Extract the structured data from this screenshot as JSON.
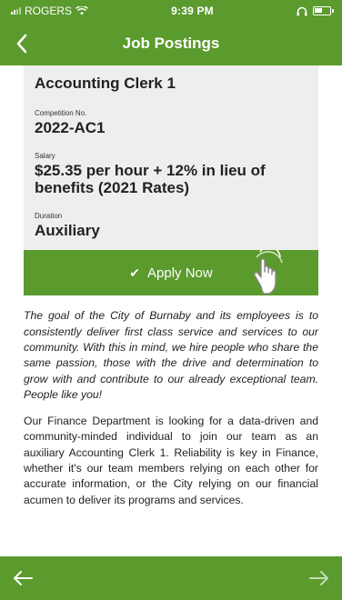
{
  "status_bar": {
    "carrier": "ROGERS",
    "time": "9:39 PM"
  },
  "nav": {
    "title": "Job Postings"
  },
  "job": {
    "title": "Accounting Clerk 1",
    "competition_label": "Competition No.",
    "competition_value": "2022-AC1",
    "salary_label": "Salary",
    "salary_value": "$25.35 per hour + 12% in lieu of benefits (2021 Rates)",
    "duration_label": "Duration",
    "duration_value": "Auxiliary"
  },
  "apply": {
    "label": "Apply Now"
  },
  "description": {
    "p1": "The goal of the City of Burnaby and its employees is to consistently deliver first class service and services to our community.  With this in mind, we hire people who share the same passion, those with the drive and determination to grow with and contribute to our already exceptional team. People like you!",
    "p2": "Our Finance Department is looking for a data-driven and community-minded individual to join our team as an auxiliary Accounting Clerk 1. Reliability is key in Finance, whether it's our team members relying on each other for accurate information, or the City relying on our financial acumen to deliver its programs and services."
  },
  "colors": {
    "brand_green": "#5b9a2d",
    "card_bg": "#eeeeee"
  }
}
